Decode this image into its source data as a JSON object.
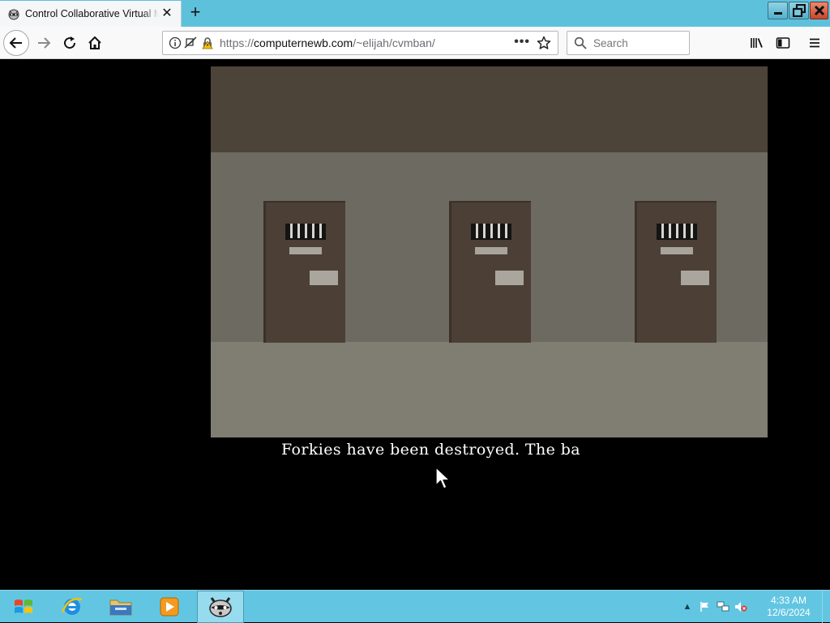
{
  "browser": {
    "tab_title": "Control Collaborative Virtual Machine",
    "tab_close": "✕",
    "new_tab": "+",
    "url_scheme": "https://",
    "url_host": "computernewb.com",
    "url_path": "/~elijah/cvmban/",
    "url_more": "•••",
    "search_placeholder": "Search"
  },
  "game": {
    "caption": "Forkies have been destroyed. The ba"
  },
  "taskbar": {
    "clock_time": "4:33 AM",
    "clock_date": "12/6/2024",
    "tray_chevron": "▲"
  },
  "colors": {
    "titlebar": "#5ec1dc",
    "taskbar": "#62c6e2",
    "ceiling": "#4d4439",
    "wall": "#6d6a62",
    "floor": "#807d72",
    "door": "#4b3f36"
  }
}
